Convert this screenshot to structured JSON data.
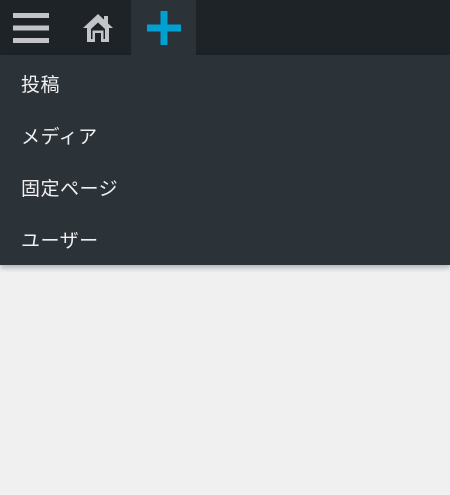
{
  "admin_bar": {
    "icons": {
      "menu": "hamburger-menu-icon",
      "home": "home-icon",
      "new": "plus-icon"
    },
    "colors": {
      "bar_background": "#1d2327",
      "active_background": "#2c3338",
      "plus_accent": "#00a0d2",
      "icon_gray": "#c3c4c7"
    }
  },
  "new_content_menu": {
    "items": [
      {
        "label": "投稿"
      },
      {
        "label": "メディア"
      },
      {
        "label": "固定ページ"
      },
      {
        "label": "ユーザー"
      }
    ]
  }
}
